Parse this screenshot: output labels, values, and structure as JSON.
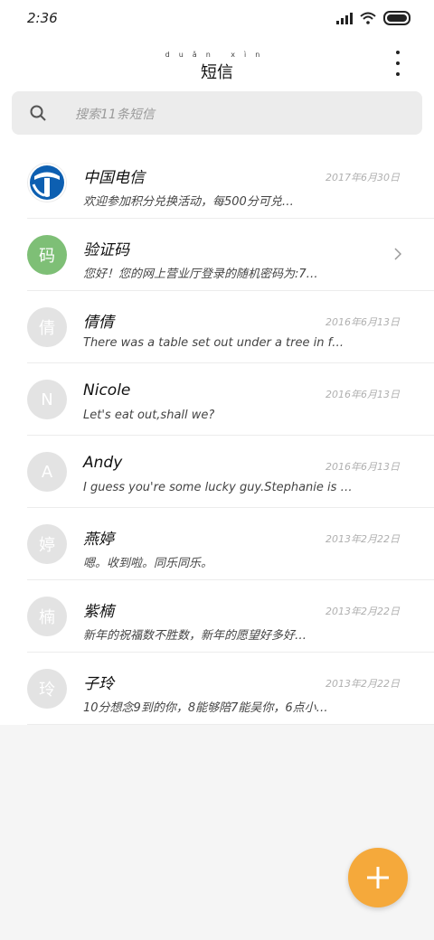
{
  "status": {
    "time": "2:36"
  },
  "header": {
    "title_pinyin": "duǎn xìn",
    "title": "短信"
  },
  "search": {
    "placeholder": "搜索11条短信"
  },
  "messages": [
    {
      "avatar": "",
      "avatar_style": "logo",
      "name": "中国电信",
      "snippet": "欢迎参加积分兑换活动，每500分可兑…",
      "date": "2017年6月30日"
    },
    {
      "avatar": "码",
      "avatar_style": "green",
      "name": "验证码",
      "snippet": "您好！您的网上营业厅登录的随机密码为:7…",
      "date": ""
    },
    {
      "avatar": "倩",
      "avatar_style": "grey",
      "name": "倩倩",
      "snippet": "There was a table set out under a tree in f…",
      "date": "2016年6月13日"
    },
    {
      "avatar": "N",
      "avatar_style": "grey",
      "name": "Nicole",
      "snippet": "Let's eat out,shall we?",
      "date": "2016年6月13日"
    },
    {
      "avatar": "A",
      "avatar_style": "grey",
      "name": "Andy",
      "snippet": "I guess you're some lucky guy.Stephanie is a …",
      "date": "2016年6月13日"
    },
    {
      "avatar": "婷",
      "avatar_style": "grey",
      "name": "燕婷",
      "snippet": "嗯。收到啦。同乐同乐。",
      "date": "2013年2月22日"
    },
    {
      "avatar": "楠",
      "avatar_style": "grey",
      "name": "紫楠",
      "snippet": "新年的祝福数不胜数，新年的愿望好多好…",
      "date": "2013年2月22日"
    },
    {
      "avatar": "玲",
      "avatar_style": "grey",
      "name": "子玲",
      "snippet": "10分想念9到的你，8能够陪7能吴你，6点小…",
      "date": "2013年2月22日"
    }
  ],
  "colors": {
    "fab": "#f5a93b",
    "avatar_green": "#7ebf76",
    "avatar_grey": "#e3e3e3"
  },
  "icons": {
    "search": "search-icon",
    "more": "more-vertical-icon",
    "fab": "plus-icon",
    "chevron": "chevron-right-icon"
  }
}
